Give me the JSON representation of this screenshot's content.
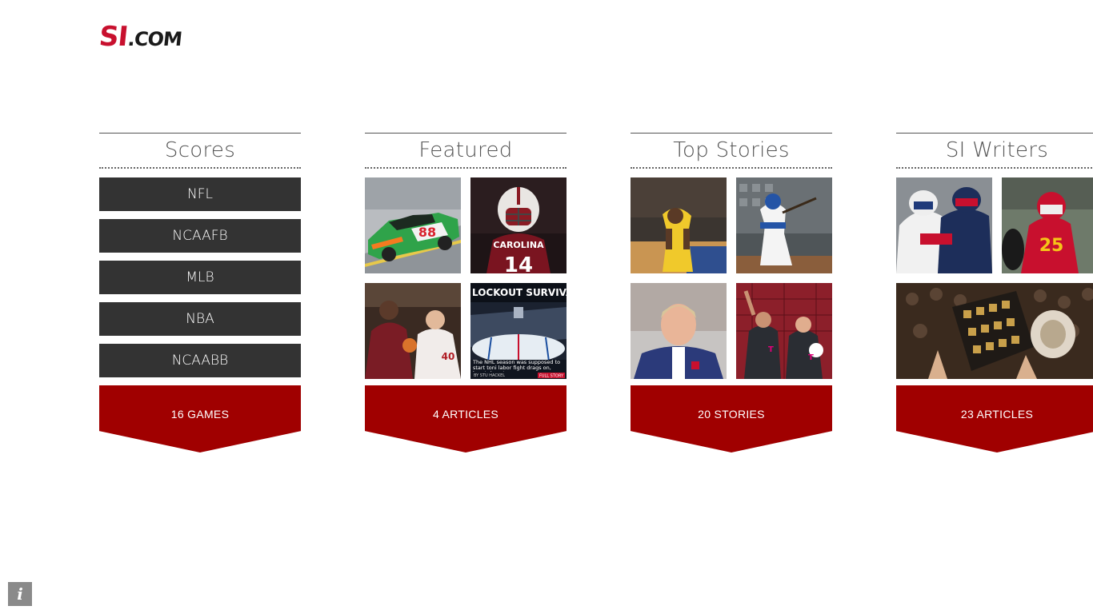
{
  "logo": {
    "si": "SI",
    "dotcom": ".COM"
  },
  "sections": {
    "scores": {
      "title": "Scores",
      "items": [
        "NFL",
        "NCAAFB",
        "MLB",
        "NBA",
        "NCAABB"
      ],
      "count": "16 GAMES"
    },
    "featured": {
      "title": "Featured",
      "count": "4 ARTICLES",
      "tiles": {
        "car_number": "88",
        "jersey_team": "CAROLINA",
        "jersey_number": "14",
        "lockout_headline": "LOCKOUT SURVIVAL G",
        "lockout_caption": "The NHL season was supposed to start toni labor fight drags on, here's how to cure your",
        "lockout_byline": "BY STU HACKEL",
        "lockout_link": "FULL STORY"
      }
    },
    "top_stories": {
      "title": "Top Stories",
      "count": "20 STORIES"
    },
    "si_writers": {
      "title": "SI Writers",
      "count": "23 ARTICLES"
    }
  },
  "info_button": {
    "label": "i"
  },
  "colors": {
    "accent_red": "#a00000",
    "dark_tile": "#333333",
    "logo_red": "#c8102e"
  }
}
